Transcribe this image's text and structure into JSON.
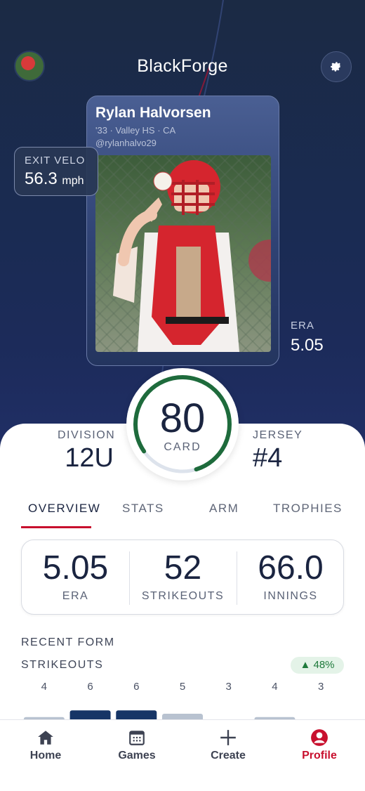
{
  "header": {
    "title": "BlackForge"
  },
  "card": {
    "name": "Rylan Halvorsen",
    "meta": "'33  ·  Valley HS  ·  CA",
    "handle": "@rylanhalvo29"
  },
  "floating_stats": {
    "exit_velo": {
      "label": "EXIT VELO",
      "value": "56.3",
      "unit": "mph"
    },
    "era": {
      "label": "ERA",
      "value": "5.05"
    }
  },
  "rating": {
    "value": "80",
    "label": "CARD",
    "fraction": 0.8,
    "color": "#1e6b3c"
  },
  "division": {
    "label": "DIVISION",
    "value": "12U"
  },
  "jersey": {
    "label": "JERSEY",
    "value": "#4"
  },
  "tabs": [
    {
      "label": "OVERVIEW",
      "active": true
    },
    {
      "label": "STATS",
      "active": false
    },
    {
      "label": "ARM",
      "active": false
    },
    {
      "label": "TROPHIES",
      "active": false
    }
  ],
  "overview_stats": [
    {
      "value": "5.05",
      "label": "ERA"
    },
    {
      "value": "52",
      "label": "STRIKEOUTS"
    },
    {
      "value": "66.0",
      "label": "INNINGS"
    }
  ],
  "recent_form": {
    "title": "RECENT FORM",
    "chart_title": "STRIKEOUTS",
    "trend": "▲ 48%",
    "trend_color": "#1e7a3b"
  },
  "chart_data": {
    "type": "bar",
    "title": "STRIKEOUTS",
    "values": [
      4,
      6,
      6,
      5,
      3,
      4,
      3
    ],
    "highlighted": [
      false,
      true,
      true,
      false,
      false,
      false,
      false
    ],
    "highlight_color": "#163566",
    "base_color": "#b8c2d0"
  },
  "bottom_nav": [
    {
      "label": "Home",
      "icon": "home-icon",
      "active": false
    },
    {
      "label": "Games",
      "icon": "calendar-icon",
      "active": false
    },
    {
      "label": "Create",
      "icon": "plus-icon",
      "active": false
    },
    {
      "label": "Profile",
      "icon": "profile-icon",
      "active": true
    }
  ],
  "colors": {
    "accent": "#c8102e",
    "navy": "#1a2440"
  }
}
